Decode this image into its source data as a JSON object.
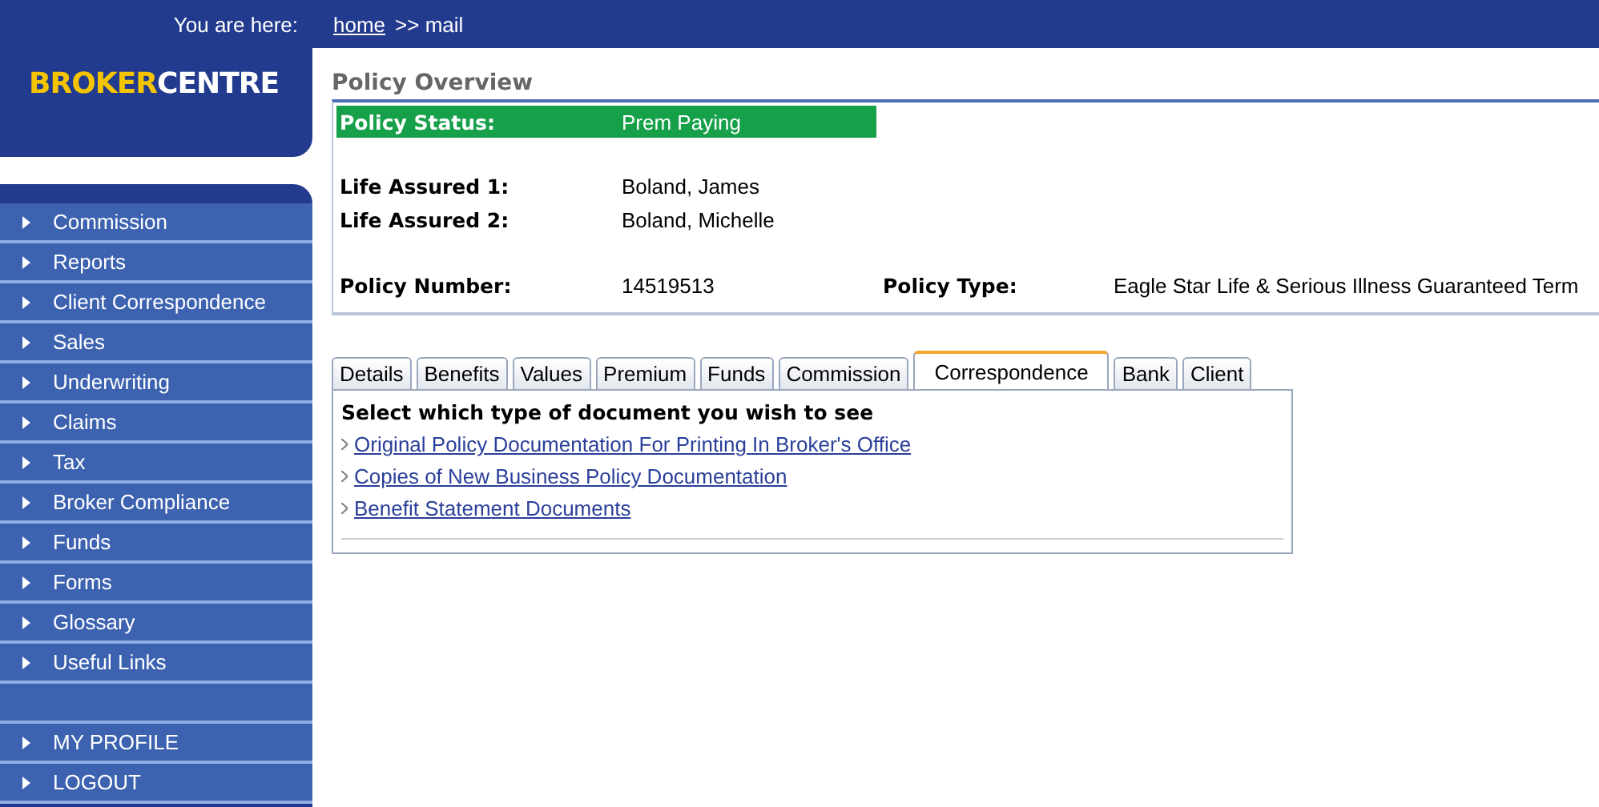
{
  "breadcrumb": {
    "label": "You are here:",
    "link": "home",
    "rest": ">>  mail"
  },
  "logo": {
    "highlight": "BROKER",
    "rest": "CENTRE"
  },
  "sidebar": {
    "items": [
      {
        "label": "Commission"
      },
      {
        "label": "Reports"
      },
      {
        "label": "Client Correspondence"
      },
      {
        "label": "Sales"
      },
      {
        "label": "Underwriting"
      },
      {
        "label": "Claims"
      },
      {
        "label": "Tax"
      },
      {
        "label": "Broker Compliance"
      },
      {
        "label": "Funds"
      },
      {
        "label": "Forms"
      },
      {
        "label": "Glossary"
      },
      {
        "label": "Useful Links"
      }
    ],
    "account_items": [
      {
        "label": "MY PROFILE"
      },
      {
        "label": "LOGOUT"
      }
    ]
  },
  "page_title": "Policy Overview",
  "policy": {
    "status_label": "Policy Status:",
    "status_value": "Prem Paying",
    "life_assured": [
      {
        "label": "Life Assured 1:",
        "value": "Boland, James"
      },
      {
        "label": "Life Assured 2:",
        "value": "Boland, Michelle"
      }
    ],
    "number_label": "Policy Number:",
    "number_value": "14519513",
    "type_label": "Policy Type:",
    "type_value": "Eagle Star Life & Serious Illness Guaranteed Term"
  },
  "tabs": [
    {
      "label": "Details",
      "selected": false
    },
    {
      "label": "Benefits",
      "selected": false
    },
    {
      "label": "Values",
      "selected": false
    },
    {
      "label": "Premium",
      "selected": false
    },
    {
      "label": "Funds",
      "selected": false
    },
    {
      "label": "Commission",
      "selected": false
    },
    {
      "label": "Correspondence",
      "selected": true
    },
    {
      "label": "Bank",
      "selected": false
    },
    {
      "label": "Client",
      "selected": false
    }
  ],
  "panel": {
    "heading": "Select which type of document you wish to see",
    "links": [
      "Original Policy Documentation For Printing In Broker's Office",
      "Copies of New Business Policy Documentation",
      "Benefit Statement Documents"
    ]
  }
}
